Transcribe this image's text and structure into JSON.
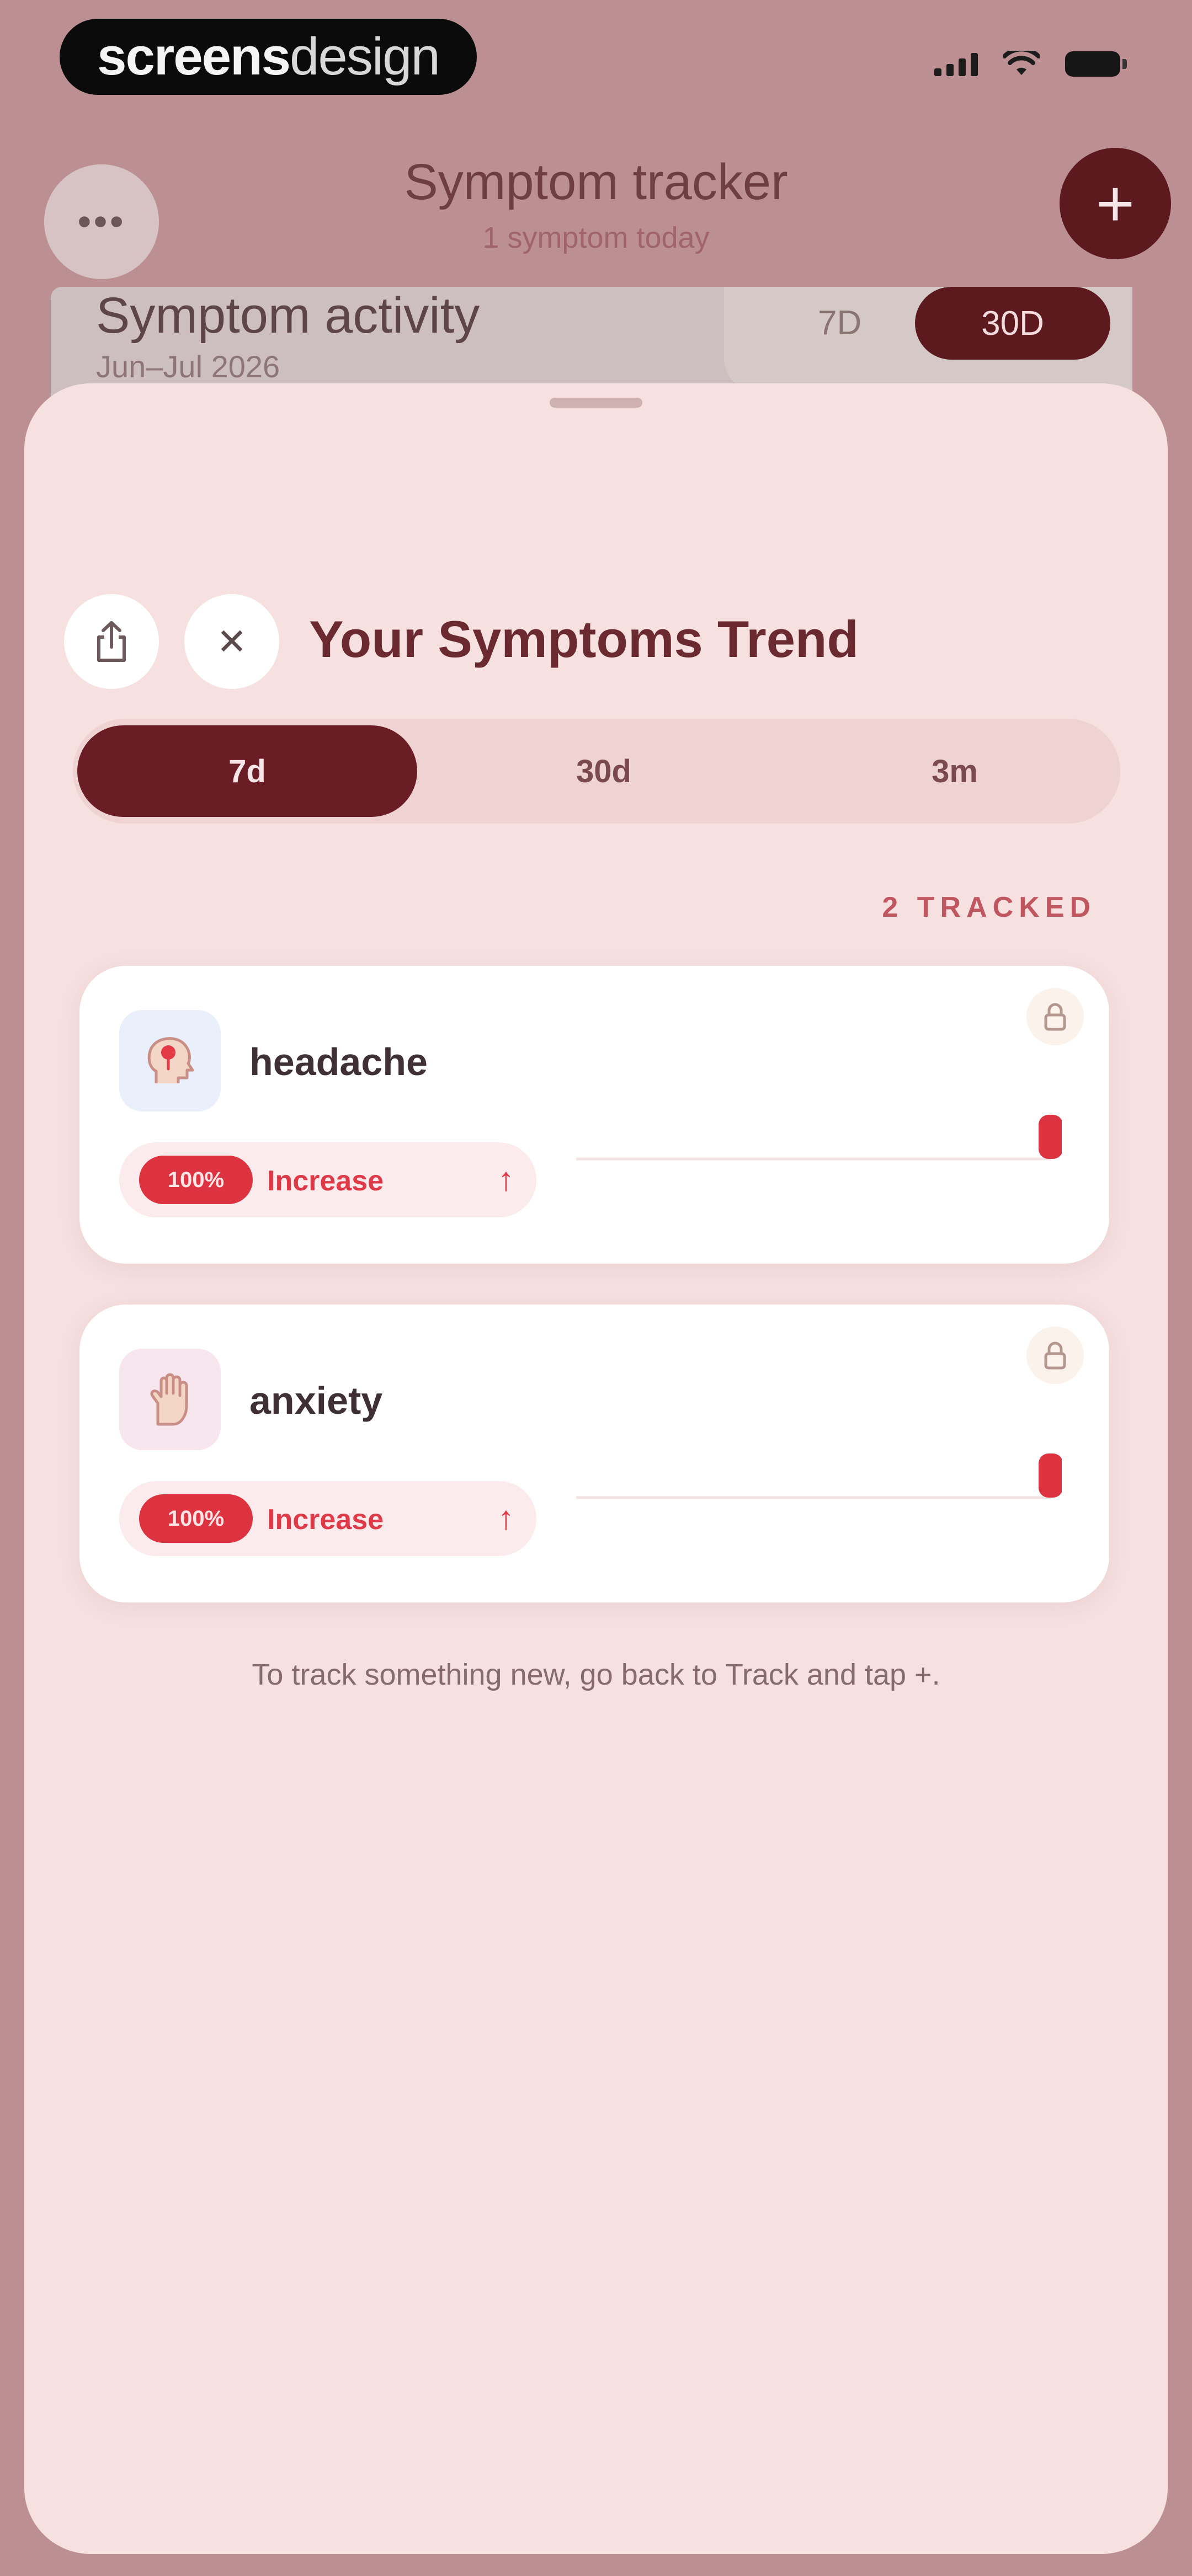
{
  "status_bar": {
    "brand_part1": "screens",
    "brand_part2": "design"
  },
  "header": {
    "menu_label": "•••",
    "title": "Symptom tracker",
    "subtitle": "1 symptom today",
    "add_label": "+"
  },
  "background_card": {
    "title": "Symptom activity",
    "subtitle": "Jun–Jul 2026",
    "range_options": [
      "7D",
      "30D"
    ],
    "selected_range": "30D"
  },
  "sheet": {
    "title": "Your Symptoms Trend",
    "close_label": "✕",
    "ranges": [
      {
        "label": "7d",
        "active": true
      },
      {
        "label": "30d",
        "active": false
      },
      {
        "label": "3m",
        "active": false
      }
    ],
    "tracked_label": "2 TRACKED",
    "symptoms": [
      {
        "name": "headache",
        "change_badge": "100%",
        "change_label": "Increase",
        "change_arrow": "↑",
        "trend": [
          0,
          0,
          0,
          0,
          0,
          0,
          1
        ]
      },
      {
        "name": "anxiety",
        "change_badge": "100%",
        "change_label": "Increase",
        "change_arrow": "↑",
        "trend": [
          0,
          0,
          0,
          0,
          0,
          0,
          0,
          1
        ]
      }
    ],
    "footer_hint": "To track something new, go back to Track and tap +."
  },
  "colors": {
    "primary": "#6a1d24",
    "sheet_bg": "#f6e0e0",
    "increase_red": "#dd3340"
  },
  "icons": {
    "share": "share-icon",
    "close": "close-icon",
    "lock": "lock-icon",
    "headache": "head-icon",
    "anxiety": "hand-icon"
  }
}
